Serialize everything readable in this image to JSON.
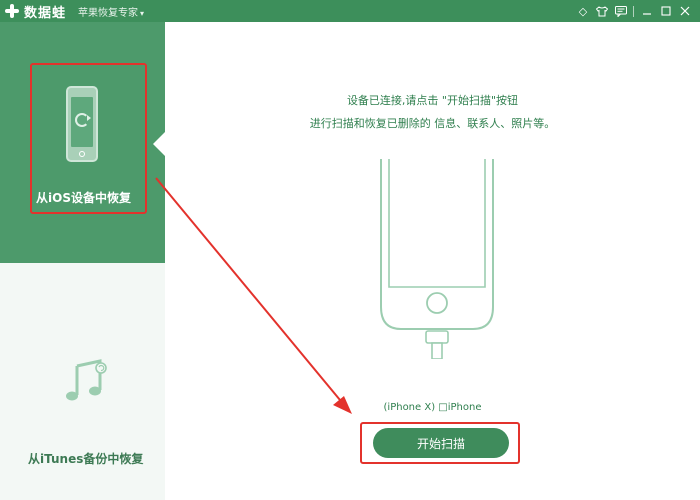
{
  "app": {
    "name": "数据蛙",
    "subtitle": "苹果恢复专家",
    "title_icons": [
      "diamond-icon",
      "shirt-icon",
      "chat-icon",
      "minimize-icon",
      "maximize-icon",
      "close-icon"
    ]
  },
  "sidebar": {
    "items": [
      {
        "label": "从iOS设备中恢复",
        "icon": "phone-restore-icon",
        "active": true
      },
      {
        "label": "从iTunes备份中恢复",
        "icon": "music-restore-icon",
        "active": false
      }
    ]
  },
  "main": {
    "instruction_line1": "设备已连接,请点击 \"开始扫描\"按钮",
    "instruction_line2": "进行扫描和恢复已删除的 信息、联系人、照片等。",
    "device_model": "(iPhone X) □iPhone",
    "start_button": "开始扫描"
  },
  "colors": {
    "brand": "#3d8f5b",
    "sidebar_active": "#4d9a6b",
    "highlight": "#e3322c"
  }
}
